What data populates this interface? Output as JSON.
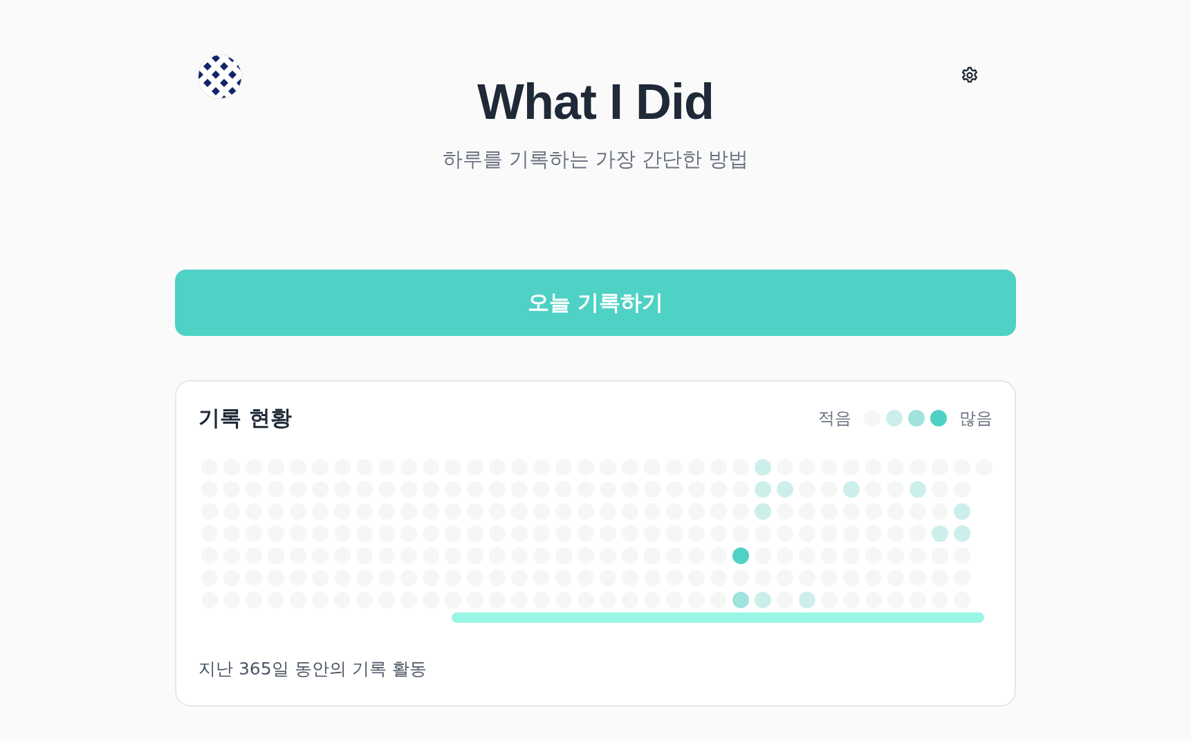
{
  "header": {
    "title": "What I Did",
    "subtitle": "하루를 기록하는 가장 간단한 방법"
  },
  "record_button": {
    "label": "오늘 기록하기"
  },
  "activity_card": {
    "title": "기록 현황",
    "legend": {
      "less_label": "적음",
      "more_label": "많음",
      "swatches": [
        {
          "color": "#f5f7f7"
        },
        {
          "color": "#cdefeb"
        },
        {
          "color": "#9fe3dc"
        },
        {
          "color": "#4fd1c5"
        }
      ]
    },
    "weeks": [
      {
        "days": [
          {
            "color": "#f5f7f7"
          },
          {
            "color": "#f5f7f7"
          },
          {
            "color": "#f5f7f7"
          },
          {
            "color": "#f5f7f7"
          },
          {
            "color": "#f5f7f7"
          },
          {
            "color": "#f5f7f7"
          },
          {
            "color": "#f5f7f7"
          }
        ]
      },
      {
        "days": [
          {
            "color": "#f5f7f7"
          },
          {
            "color": "#f5f7f7"
          },
          {
            "color": "#f5f7f7"
          },
          {
            "color": "#f5f7f7"
          },
          {
            "color": "#f5f7f7"
          },
          {
            "color": "#f5f7f7"
          },
          {
            "color": "#f5f7f7"
          }
        ]
      },
      {
        "days": [
          {
            "color": "#f5f7f7"
          },
          {
            "color": "#f5f7f7"
          },
          {
            "color": "#f5f7f7"
          },
          {
            "color": "#f5f7f7"
          },
          {
            "color": "#f5f7f7"
          },
          {
            "color": "#f5f7f7"
          },
          {
            "color": "#f5f7f7"
          }
        ]
      },
      {
        "days": [
          {
            "color": "#f5f7f7"
          },
          {
            "color": "#f5f7f7"
          },
          {
            "color": "#f5f7f7"
          },
          {
            "color": "#f5f7f7"
          },
          {
            "color": "#f5f7f7"
          },
          {
            "color": "#f5f7f7"
          },
          {
            "color": "#f5f7f7"
          }
        ]
      },
      {
        "days": [
          {
            "color": "#f5f7f7"
          },
          {
            "color": "#f5f7f7"
          },
          {
            "color": "#f5f7f7"
          },
          {
            "color": "#f5f7f7"
          },
          {
            "color": "#f5f7f7"
          },
          {
            "color": "#f5f7f7"
          },
          {
            "color": "#f5f7f7"
          }
        ]
      },
      {
        "days": [
          {
            "color": "#f5f7f7"
          },
          {
            "color": "#f5f7f7"
          },
          {
            "color": "#f5f7f7"
          },
          {
            "color": "#f5f7f7"
          },
          {
            "color": "#f5f7f7"
          },
          {
            "color": "#f5f7f7"
          },
          {
            "color": "#f5f7f7"
          }
        ]
      },
      {
        "days": [
          {
            "color": "#f5f7f7"
          },
          {
            "color": "#f5f7f7"
          },
          {
            "color": "#f5f7f7"
          },
          {
            "color": "#f5f7f7"
          },
          {
            "color": "#f5f7f7"
          },
          {
            "color": "#f5f7f7"
          },
          {
            "color": "#f5f7f7"
          }
        ]
      },
      {
        "days": [
          {
            "color": "#f5f7f7"
          },
          {
            "color": "#f5f7f7"
          },
          {
            "color": "#f5f7f7"
          },
          {
            "color": "#f5f7f7"
          },
          {
            "color": "#f5f7f7"
          },
          {
            "color": "#f5f7f7"
          },
          {
            "color": "#f5f7f7"
          }
        ]
      },
      {
        "days": [
          {
            "color": "#f5f7f7"
          },
          {
            "color": "#f5f7f7"
          },
          {
            "color": "#f5f7f7"
          },
          {
            "color": "#f5f7f7"
          },
          {
            "color": "#f5f7f7"
          },
          {
            "color": "#f5f7f7"
          },
          {
            "color": "#f5f7f7"
          }
        ]
      },
      {
        "days": [
          {
            "color": "#f5f7f7"
          },
          {
            "color": "#f5f7f7"
          },
          {
            "color": "#f5f7f7"
          },
          {
            "color": "#f5f7f7"
          },
          {
            "color": "#f5f7f7"
          },
          {
            "color": "#f5f7f7"
          },
          {
            "color": "#f5f7f7"
          }
        ]
      },
      {
        "days": [
          {
            "color": "#f5f7f7"
          },
          {
            "color": "#f5f7f7"
          },
          {
            "color": "#f5f7f7"
          },
          {
            "color": "#f5f7f7"
          },
          {
            "color": "#f5f7f7"
          },
          {
            "color": "#f5f7f7"
          },
          {
            "color": "#f5f7f7"
          }
        ]
      },
      {
        "days": [
          {
            "color": "#f5f7f7"
          },
          {
            "color": "#f5f7f7"
          },
          {
            "color": "#f5f7f7"
          },
          {
            "color": "#f5f7f7"
          },
          {
            "color": "#f5f7f7"
          },
          {
            "color": "#f5f7f7"
          },
          {
            "color": "#f5f7f7"
          }
        ]
      },
      {
        "days": [
          {
            "color": "#f5f7f7"
          },
          {
            "color": "#f5f7f7"
          },
          {
            "color": "#f5f7f7"
          },
          {
            "color": "#f5f7f7"
          },
          {
            "color": "#f5f7f7"
          },
          {
            "color": "#f5f7f7"
          },
          {
            "color": "#f5f7f7"
          }
        ]
      },
      {
        "days": [
          {
            "color": "#f5f7f7"
          },
          {
            "color": "#f5f7f7"
          },
          {
            "color": "#f5f7f7"
          },
          {
            "color": "#f5f7f7"
          },
          {
            "color": "#f5f7f7"
          },
          {
            "color": "#f5f7f7"
          },
          {
            "color": "#f5f7f7"
          }
        ]
      },
      {
        "days": [
          {
            "color": "#f5f7f7"
          },
          {
            "color": "#f5f7f7"
          },
          {
            "color": "#f5f7f7"
          },
          {
            "color": "#f5f7f7"
          },
          {
            "color": "#f5f7f7"
          },
          {
            "color": "#f5f7f7"
          },
          {
            "color": "#f5f7f7"
          }
        ]
      },
      {
        "days": [
          {
            "color": "#f5f7f7"
          },
          {
            "color": "#f5f7f7"
          },
          {
            "color": "#f5f7f7"
          },
          {
            "color": "#f5f7f7"
          },
          {
            "color": "#f5f7f7"
          },
          {
            "color": "#f5f7f7"
          },
          {
            "color": "#f5f7f7"
          }
        ]
      },
      {
        "days": [
          {
            "color": "#f5f7f7"
          },
          {
            "color": "#f5f7f7"
          },
          {
            "color": "#f5f7f7"
          },
          {
            "color": "#f5f7f7"
          },
          {
            "color": "#f5f7f7"
          },
          {
            "color": "#f5f7f7"
          },
          {
            "color": "#f5f7f7"
          }
        ]
      },
      {
        "days": [
          {
            "color": "#f5f7f7"
          },
          {
            "color": "#f5f7f7"
          },
          {
            "color": "#f5f7f7"
          },
          {
            "color": "#f5f7f7"
          },
          {
            "color": "#f5f7f7"
          },
          {
            "color": "#f5f7f7"
          },
          {
            "color": "#f5f7f7"
          }
        ]
      },
      {
        "days": [
          {
            "color": "#f5f7f7"
          },
          {
            "color": "#f5f7f7"
          },
          {
            "color": "#f5f7f7"
          },
          {
            "color": "#f5f7f7"
          },
          {
            "color": "#f5f7f7"
          },
          {
            "color": "#f5f7f7"
          },
          {
            "color": "#f5f7f7"
          }
        ]
      },
      {
        "days": [
          {
            "color": "#f5f7f7"
          },
          {
            "color": "#f5f7f7"
          },
          {
            "color": "#f5f7f7"
          },
          {
            "color": "#f5f7f7"
          },
          {
            "color": "#f5f7f7"
          },
          {
            "color": "#f5f7f7"
          },
          {
            "color": "#f5f7f7"
          }
        ]
      },
      {
        "days": [
          {
            "color": "#f5f7f7"
          },
          {
            "color": "#f5f7f7"
          },
          {
            "color": "#f5f7f7"
          },
          {
            "color": "#f5f7f7"
          },
          {
            "color": "#f5f7f7"
          },
          {
            "color": "#f5f7f7"
          },
          {
            "color": "#f5f7f7"
          }
        ]
      },
      {
        "days": [
          {
            "color": "#f5f7f7"
          },
          {
            "color": "#f5f7f7"
          },
          {
            "color": "#f5f7f7"
          },
          {
            "color": "#f5f7f7"
          },
          {
            "color": "#f5f7f7"
          },
          {
            "color": "#f5f7f7"
          },
          {
            "color": "#f5f7f7"
          }
        ]
      },
      {
        "days": [
          {
            "color": "#f5f7f7"
          },
          {
            "color": "#f5f7f7"
          },
          {
            "color": "#f5f7f7"
          },
          {
            "color": "#f5f7f7"
          },
          {
            "color": "#f5f7f7"
          },
          {
            "color": "#f5f7f7"
          },
          {
            "color": "#f5f7f7"
          }
        ]
      },
      {
        "days": [
          {
            "color": "#f5f7f7"
          },
          {
            "color": "#f5f7f7"
          },
          {
            "color": "#f5f7f7"
          },
          {
            "color": "#f5f7f7"
          },
          {
            "color": "#f5f7f7"
          },
          {
            "color": "#f5f7f7"
          },
          {
            "color": "#f5f7f7"
          }
        ]
      },
      {
        "days": [
          {
            "color": "#f5f7f7"
          },
          {
            "color": "#f5f7f7"
          },
          {
            "color": "#f5f7f7"
          },
          {
            "color": "#f5f7f7"
          },
          {
            "color": "#4fd1c5"
          },
          {
            "color": "#f5f7f7"
          },
          {
            "color": "#9fe3dc"
          }
        ]
      },
      {
        "days": [
          {
            "color": "#cdefeb"
          },
          {
            "color": "#cdefeb"
          },
          {
            "color": "#cdefeb"
          },
          {
            "color": "#f5f7f7"
          },
          {
            "color": "#f5f7f7"
          },
          {
            "color": "#f5f7f7"
          },
          {
            "color": "#cdefeb"
          }
        ]
      },
      {
        "days": [
          {
            "color": "#f5f7f7"
          },
          {
            "color": "#cdefeb"
          },
          {
            "color": "#f5f7f7"
          },
          {
            "color": "#f5f7f7"
          },
          {
            "color": "#f5f7f7"
          },
          {
            "color": "#f5f7f7"
          },
          {
            "color": "#f5f7f7"
          }
        ]
      },
      {
        "days": [
          {
            "color": "#f5f7f7"
          },
          {
            "color": "#f5f7f7"
          },
          {
            "color": "#f5f7f7"
          },
          {
            "color": "#f5f7f7"
          },
          {
            "color": "#f5f7f7"
          },
          {
            "color": "#f5f7f7"
          },
          {
            "color": "#cdefeb"
          }
        ]
      },
      {
        "days": [
          {
            "color": "#f5f7f7"
          },
          {
            "color": "#f5f7f7"
          },
          {
            "color": "#f5f7f7"
          },
          {
            "color": "#f5f7f7"
          },
          {
            "color": "#f5f7f7"
          },
          {
            "color": "#f5f7f7"
          },
          {
            "color": "#f5f7f7"
          }
        ]
      },
      {
        "days": [
          {
            "color": "#f5f7f7"
          },
          {
            "color": "#cdefeb"
          },
          {
            "color": "#f5f7f7"
          },
          {
            "color": "#f5f7f7"
          },
          {
            "color": "#f5f7f7"
          },
          {
            "color": "#f5f7f7"
          },
          {
            "color": "#f5f7f7"
          }
        ]
      },
      {
        "days": [
          {
            "color": "#f5f7f7"
          },
          {
            "color": "#f5f7f7"
          },
          {
            "color": "#f5f7f7"
          },
          {
            "color": "#f5f7f7"
          },
          {
            "color": "#f5f7f7"
          },
          {
            "color": "#f5f7f7"
          },
          {
            "color": "#f5f7f7"
          }
        ]
      },
      {
        "days": [
          {
            "color": "#f5f7f7"
          },
          {
            "color": "#f5f7f7"
          },
          {
            "color": "#f5f7f7"
          },
          {
            "color": "#f5f7f7"
          },
          {
            "color": "#f5f7f7"
          },
          {
            "color": "#f5f7f7"
          },
          {
            "color": "#f5f7f7"
          }
        ]
      },
      {
        "days": [
          {
            "color": "#f5f7f7"
          },
          {
            "color": "#cdefeb"
          },
          {
            "color": "#f5f7f7"
          },
          {
            "color": "#f5f7f7"
          },
          {
            "color": "#f5f7f7"
          },
          {
            "color": "#f5f7f7"
          },
          {
            "color": "#f5f7f7"
          }
        ]
      },
      {
        "days": [
          {
            "color": "#f5f7f7"
          },
          {
            "color": "#f5f7f7"
          },
          {
            "color": "#f5f7f7"
          },
          {
            "color": "#cdefeb"
          },
          {
            "color": "#f5f7f7"
          },
          {
            "color": "#f5f7f7"
          },
          {
            "color": "#f5f7f7"
          }
        ]
      },
      {
        "days": [
          {
            "color": "#f5f7f7"
          },
          {
            "color": "#f5f7f7"
          },
          {
            "color": "#cdefeb"
          },
          {
            "color": "#cdefeb"
          },
          {
            "color": "#f5f7f7"
          },
          {
            "color": "#f5f7f7"
          },
          {
            "color": "#f5f7f7"
          }
        ]
      },
      {
        "days": [
          {
            "color": "#f5f7f7"
          }
        ]
      }
    ],
    "footer_text": "지난 365일 동안의 기록 활동"
  }
}
